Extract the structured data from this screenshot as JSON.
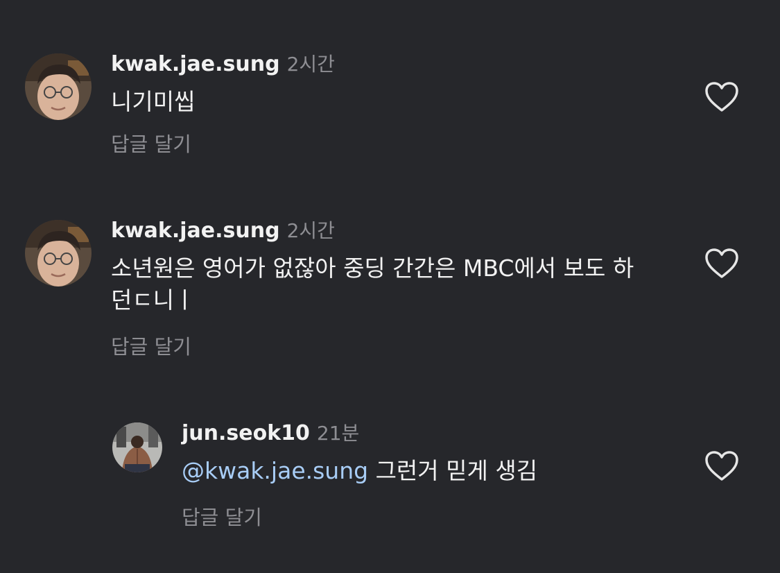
{
  "comments": [
    {
      "username": "kwak.jae.sung",
      "time": "2시간",
      "text": "니기미씹",
      "reply_label": "답글 달기"
    },
    {
      "username": "kwak.jae.sung",
      "time": "2시간",
      "text": "소년원은 영어가 없잖아  중딩 간간은 MBC에서 보도 하던ㄷ니ㅣ",
      "reply_label": "답글 달기"
    }
  ],
  "replies": [
    {
      "username": "jun.seok10",
      "time": "21분",
      "mention": "@kwak.jae.sung",
      "text": " 그런거 믿게 생김",
      "reply_label": "답글 달기"
    }
  ],
  "icons": {
    "like": "heart-outline-icon",
    "avatar_main": "profile-photo",
    "avatar_reply": "profile-photo"
  },
  "colors": {
    "background": "#26272b",
    "text_primary": "#f2f2f2",
    "text_secondary": "#8e8e93",
    "mention": "#a8cdf6"
  }
}
